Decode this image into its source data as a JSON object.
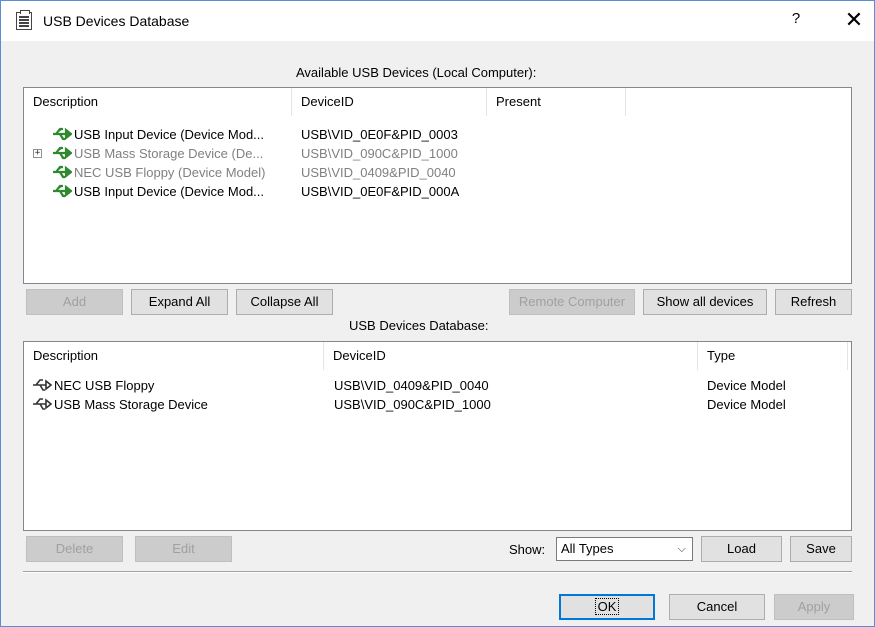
{
  "window": {
    "title": "USB Devices Database",
    "help_label": "?",
    "close_label": "✕"
  },
  "available": {
    "caption": "Available USB Devices (Local Computer):",
    "columns": [
      "Description",
      "DeviceID",
      "Present"
    ],
    "rows": [
      {
        "description": "USB Input Device (Device Mod...",
        "device_id": "USB\\VID_0E0F&PID_0003",
        "present": "",
        "grayed": false,
        "expandable": false
      },
      {
        "description": "USB Mass Storage Device (De...",
        "device_id": "USB\\VID_090C&PID_1000",
        "present": "",
        "grayed": true,
        "expandable": true
      },
      {
        "description": "NEC USB Floppy (Device Model)",
        "device_id": "USB\\VID_0409&PID_0040",
        "present": "",
        "grayed": true,
        "expandable": false
      },
      {
        "description": "USB Input Device (Device Mod...",
        "device_id": "USB\\VID_0E0F&PID_000A",
        "present": "",
        "grayed": false,
        "expandable": false
      }
    ],
    "expand_symbol": "+",
    "buttons": {
      "add": "Add",
      "expand_all": "Expand All",
      "collapse_all": "Collapse All",
      "remote_computer": "Remote Computer",
      "show_all_devices": "Show all devices",
      "refresh": "Refresh"
    }
  },
  "database": {
    "caption": "USB Devices Database:",
    "columns": [
      "Description",
      "DeviceID",
      "Type"
    ],
    "rows": [
      {
        "description": "NEC USB Floppy",
        "device_id": "USB\\VID_0409&PID_0040",
        "type": "Device Model"
      },
      {
        "description": "USB Mass Storage Device",
        "device_id": "USB\\VID_090C&PID_1000",
        "type": "Device Model"
      }
    ],
    "buttons": {
      "delete": "Delete",
      "edit": "Edit",
      "load": "Load",
      "save": "Save"
    },
    "show_label": "Show:",
    "show_value": "All Types"
  },
  "footer": {
    "ok": "OK",
    "cancel": "Cancel",
    "apply": "Apply"
  },
  "colors": {
    "usb_icon_active": "#2f8a2f",
    "usb_icon_gray": "#808080",
    "usb_icon_dark": "#333333",
    "accent": "#0078d7"
  }
}
